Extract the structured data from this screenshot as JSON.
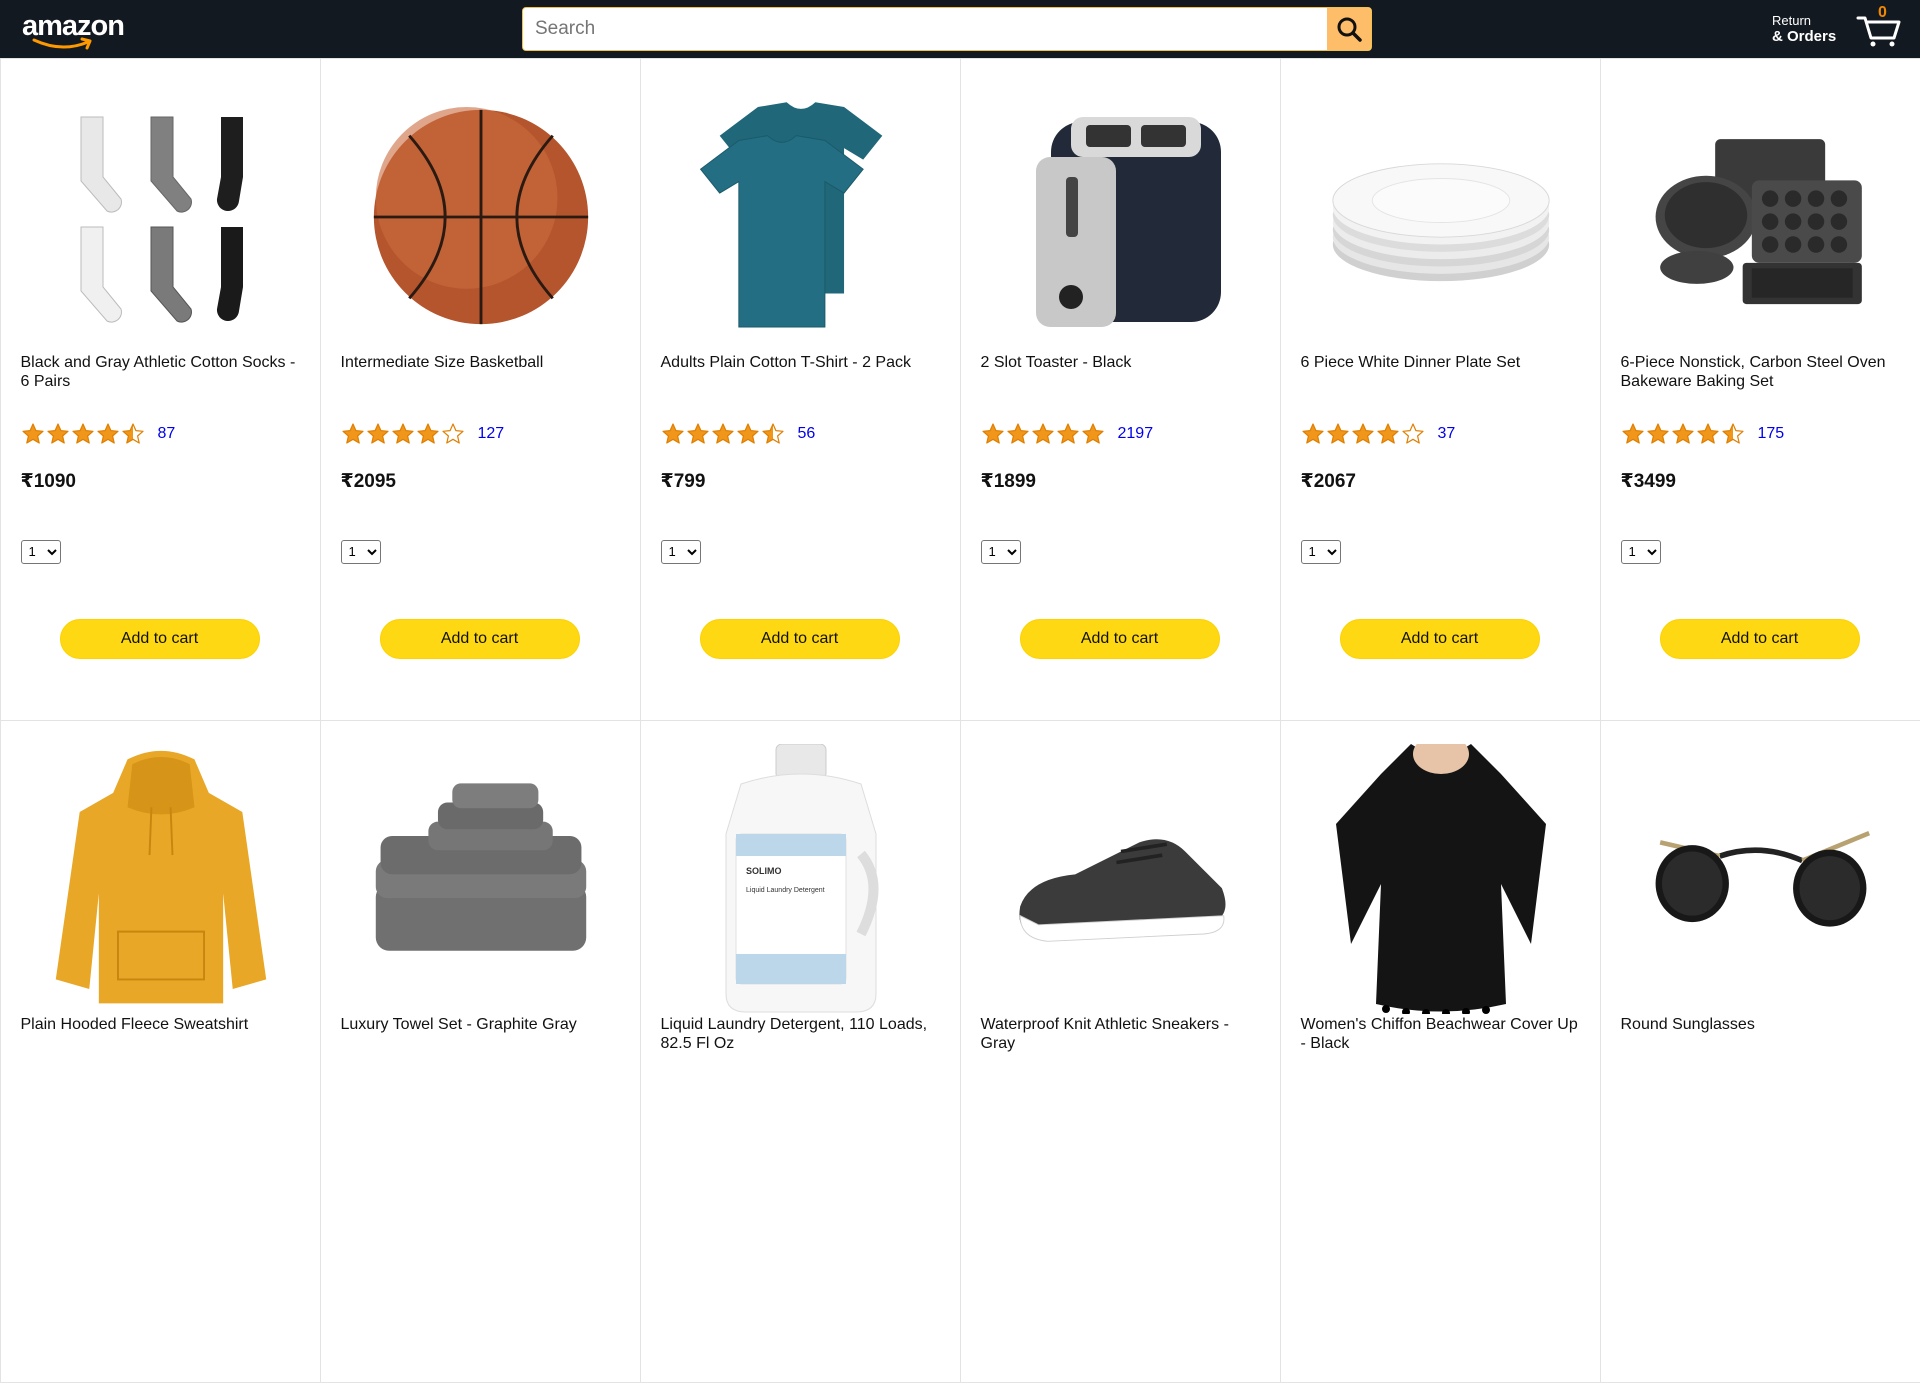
{
  "header": {
    "logo_text": "amazon",
    "search_placeholder": "Search",
    "returns_line1": "Return",
    "returns_line2": "& Orders",
    "cart_count": "0",
    "colors": {
      "topbar": "#131921",
      "search_button": "#febd69",
      "cart_count": "#f08804"
    }
  },
  "products": [
    {
      "title": "Black and Gray Athletic Cotton Socks - 6 Pairs",
      "rating": 4.5,
      "rating_count": "87",
      "price": "₹1090",
      "qty": "1",
      "cta": "Add to cart",
      "image": "socks"
    },
    {
      "title": "Intermediate Size Basketball",
      "rating": 4.0,
      "rating_count": "127",
      "price": "₹2095",
      "qty": "1",
      "cta": "Add to cart",
      "image": "basketball"
    },
    {
      "title": "Adults Plain Cotton T-Shirt - 2 Pack",
      "rating": 4.5,
      "rating_count": "56",
      "price": "₹799",
      "qty": "1",
      "cta": "Add to cart",
      "image": "tshirt"
    },
    {
      "title": "2 Slot Toaster - Black",
      "rating": 5.0,
      "rating_count": "2197",
      "price": "₹1899",
      "qty": "1",
      "cta": "Add to cart",
      "image": "toaster"
    },
    {
      "title": "6 Piece White Dinner Plate Set",
      "rating": 4.0,
      "rating_count": "37",
      "price": "₹2067",
      "qty": "1",
      "cta": "Add to cart",
      "image": "plates"
    },
    {
      "title": "6-Piece Nonstick, Carbon Steel Oven Bakeware Baking Set",
      "rating": 4.5,
      "rating_count": "175",
      "price": "₹3499",
      "qty": "1",
      "cta": "Add to cart",
      "image": "bakeware"
    },
    {
      "title": "Plain Hooded Fleece Sweatshirt",
      "image": "hoodie"
    },
    {
      "title": "Luxury Towel Set - Graphite Gray",
      "image": "towels"
    },
    {
      "title": "Liquid Laundry Detergent, 110 Loads, 82.5 Fl Oz",
      "image": "detergent",
      "label_brand": "SOLIMO",
      "label_text": "Liquid Laundry Detergent"
    },
    {
      "title": "Waterproof Knit Athletic Sneakers - Gray",
      "image": "sneakers"
    },
    {
      "title": "Women's Chiffon Beachwear Cover Up - Black",
      "image": "coverup"
    },
    {
      "title": "Round Sunglasses",
      "image": "sunglasses"
    }
  ]
}
